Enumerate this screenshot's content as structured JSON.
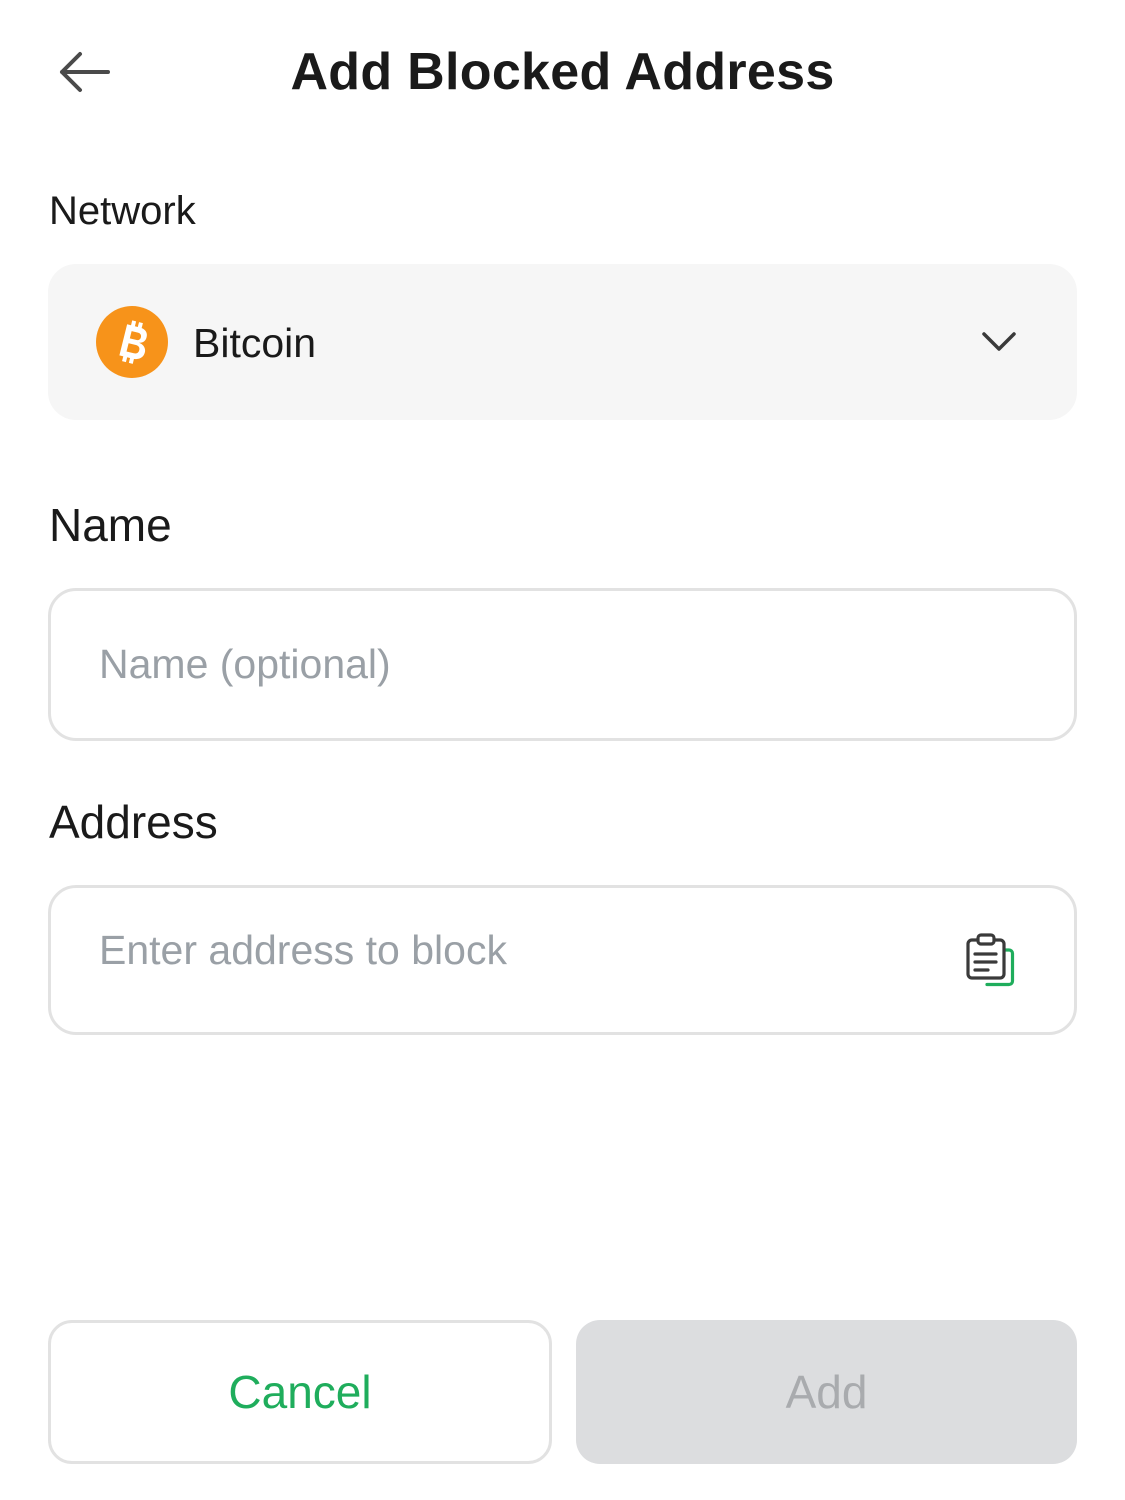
{
  "header": {
    "title": "Add Blocked Address",
    "back_icon": "arrow-left-icon"
  },
  "network": {
    "label": "Network",
    "selected": "Bitcoin",
    "coin_icon": "bitcoin-icon",
    "coin_color": "#f7931a",
    "dropdown_icon": "chevron-down-icon"
  },
  "name": {
    "label": "Name",
    "placeholder": "Name (optional)",
    "value": ""
  },
  "address": {
    "label": "Address",
    "placeholder": "Enter address to block",
    "value": "",
    "paste_icon": "clipboard-paste-icon"
  },
  "actions": {
    "cancel_label": "Cancel",
    "add_label": "Add",
    "cancel_color": "#1fad5c",
    "add_enabled": false
  }
}
